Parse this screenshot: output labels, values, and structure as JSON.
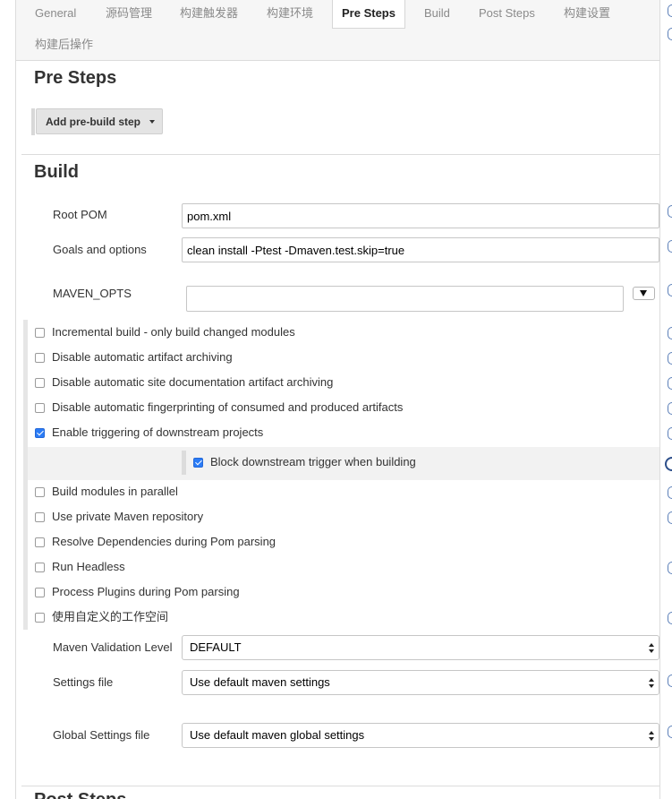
{
  "tabs": [
    {
      "label": "General",
      "active": false
    },
    {
      "label": "源码管理",
      "active": false
    },
    {
      "label": "构建触发器",
      "active": false
    },
    {
      "label": "构建环境",
      "active": false
    },
    {
      "label": "Pre Steps",
      "active": true
    },
    {
      "label": "Build",
      "active": false
    },
    {
      "label": "Post Steps",
      "active": false
    },
    {
      "label": "构建设置",
      "active": false
    },
    {
      "label": "构建后操作",
      "active": false
    }
  ],
  "pre_steps": {
    "title": "Pre Steps",
    "add_button_label": "Add pre-build step"
  },
  "build": {
    "title": "Build",
    "root_pom": {
      "label": "Root POM",
      "value": "pom.xml"
    },
    "goals": {
      "label": "Goals and options",
      "value": "clean install -Ptest -Dmaven.test.skip=true"
    },
    "maven_opts": {
      "label": "MAVEN_OPTS",
      "value": ""
    },
    "options": [
      {
        "label": "Incremental build - only build changed modules",
        "checked": false
      },
      {
        "label": "Disable automatic artifact archiving",
        "checked": false
      },
      {
        "label": "Disable automatic site documentation artifact archiving",
        "checked": false
      },
      {
        "label": "Disable automatic fingerprinting of consumed and produced artifacts",
        "checked": false
      },
      {
        "label": "Enable triggering of downstream projects",
        "checked": true
      },
      {
        "label": "Build modules in parallel",
        "checked": false
      },
      {
        "label": "Use private Maven repository",
        "checked": false
      },
      {
        "label": "Resolve Dependencies during Pom parsing",
        "checked": false
      },
      {
        "label": "Run Headless",
        "checked": false
      },
      {
        "label": "Process Plugins during Pom parsing",
        "checked": false
      },
      {
        "label": "使用自定义的工作空间",
        "checked": false
      }
    ],
    "block_downstream": {
      "label": "Block downstream trigger when building",
      "checked": true
    },
    "validation_level": {
      "label": "Maven Validation Level",
      "value": "DEFAULT"
    },
    "settings_file": {
      "label": "Settings file",
      "value": "Use default maven settings"
    },
    "global_settings_file": {
      "label": "Global Settings file",
      "value": "Use default maven global settings"
    }
  },
  "post_steps": {
    "title": "Post Steps"
  },
  "icons": {
    "help": "help-icon",
    "dropdown_caret": "caret-down-icon",
    "select_arrows": "select-arrows-icon",
    "expand": "expand-arrow-icon",
    "checkmark": "checkmark-icon"
  },
  "colors": {
    "checkbox_checked": "#2b7cf6",
    "help_icon": "#5b7fb8",
    "tab_bar_background": "#f6f6f6",
    "active_tab_background": "#ffffff",
    "nested_block_background": "#f2f2f2"
  }
}
